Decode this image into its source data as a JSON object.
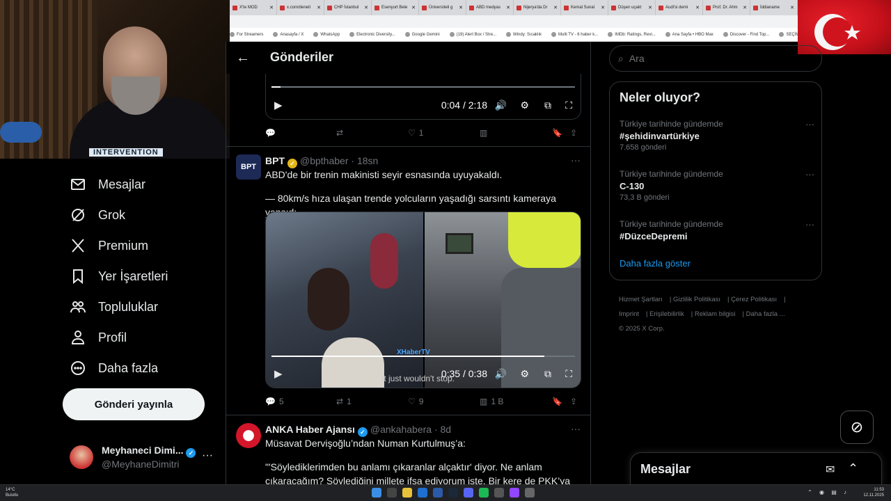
{
  "webcam": {
    "overlay_label": "INTERVENTION"
  },
  "browser": {
    "tabs": [
      "X'te MOD",
      "x.com/deneti",
      "CHP İstanbul",
      "Esenyurt Bele",
      "Üniversiteli g",
      "ABD medyas",
      "Nijerya'da Dr",
      "Kemal Sunal",
      "Düşen uçakt",
      "Audi'si demi",
      "Prof. Dr. Ahm",
      "İddianame"
    ],
    "bookmarks": [
      "For Streamers",
      "Anasayfa / X",
      "WhatsApp",
      "Electronic Diversity...",
      "Google Gemini",
      "(19) Alert Box / Stre...",
      "Windy: Sıcaklık",
      "Multi TV - 6 haber k...",
      "IMDb: Ratings, Revi...",
      "Ana Sayfa • HBO Max",
      "Discover - Find Top...",
      "SEÇİM SONUÇLARI...",
      "Ch"
    ]
  },
  "nav": {
    "items": [
      {
        "label": "Mesajlar",
        "icon": "envelope-icon"
      },
      {
        "label": "Grok",
        "icon": "grok-icon"
      },
      {
        "label": "Premium",
        "icon": "x-logo-icon"
      },
      {
        "label": "Yer İşaretleri",
        "icon": "bookmark-icon"
      },
      {
        "label": "Topluluklar",
        "icon": "communities-icon"
      },
      {
        "label": "Profil",
        "icon": "profile-icon"
      },
      {
        "label": "Daha fazla",
        "icon": "more-circle-icon"
      }
    ],
    "post_button": "Gönderi yayınla",
    "profile": {
      "name": "Meyhaneci Dimi...",
      "handle": "@MeyhaneDimitri"
    }
  },
  "main": {
    "header_title": "Gönderiler",
    "video1": {
      "time": "0:04 / 2:18",
      "progress": 0.03
    },
    "actions1": {
      "replies": "",
      "reposts": "",
      "likes": "1",
      "views": ""
    },
    "post1": {
      "author": "BPT",
      "handle": "@bpthaber",
      "time": "18sn",
      "line1": "ABD'de bir trenin makinisti seyir esnasında uyuyakaldı.",
      "line2": "— 80km/s hıza ulaşan trende yolcuların yaşadığı sarsıntı kameraya yansıdı.",
      "video_time": "0:35 / 0:38",
      "progress": 0.9,
      "subtitle": "It just wouldn't stop.",
      "watermark": "XHaberTV",
      "replies": "5",
      "reposts": "1",
      "likes": "9",
      "views": "1 B"
    },
    "post2": {
      "author": "ANKA Haber Ajansı",
      "handle": "@ankahabera",
      "time": "8d",
      "line1": "Müsavat Dervişoğlu’ndan Numan Kurtulmuş’a:",
      "line2": "\"'Söylediklerimden bu anlamı çıkaranlar alçaktır' diyor. Ne anlam çıkaracağım? Söylediğini millete ifşa ediyorum işte. Bir kere de PKK’ya alçak"
    }
  },
  "right": {
    "search_placeholder": "Ara",
    "trends_title": "Neler oluyor?",
    "trends": [
      {
        "context": "Türkiye tarihinde gündemde",
        "name": "#şehidinvartürkiye",
        "count": "7.658 gönderi"
      },
      {
        "context": "Türkiye tarihinde gündemde",
        "name": "C-130",
        "count": "73,3 B gönderi"
      },
      {
        "context": "Türkiye tarihinde gündemde",
        "name": "#DüzceDepremi",
        "count": ""
      }
    ],
    "show_more": "Daha fazla göster",
    "footer": [
      "Hizmet Şartları",
      "Gizlilik Politikası",
      "Çerez Politikası",
      "Imprint",
      "Erişilebilirlik",
      "Reklam bilgisi",
      "Daha fazla ...",
      "© 2025 X Corp."
    ],
    "messages_drawer": "Mesajlar"
  },
  "taskbar": {
    "weather_temp": "14°C",
    "weather_desc": "Bulutlu",
    "time": "11:53",
    "date": "12.11.2025"
  }
}
